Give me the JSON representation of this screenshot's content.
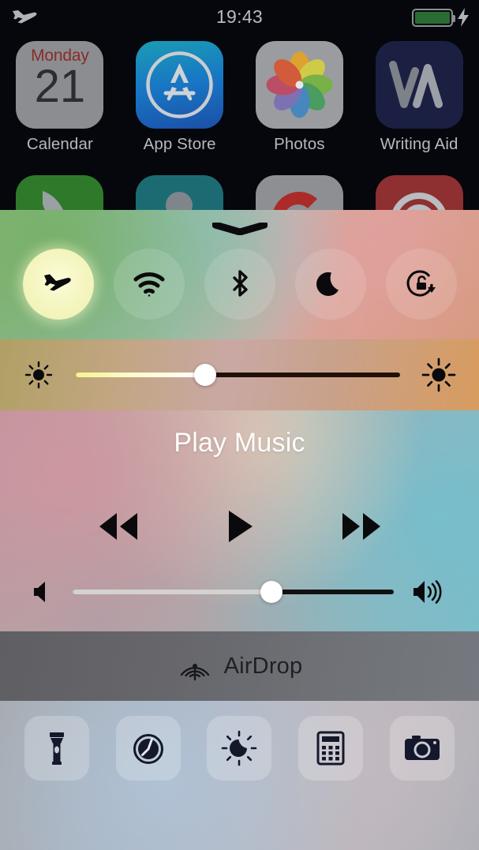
{
  "status_bar": {
    "airplane_icon": "airplane-icon",
    "time": "19:43",
    "battery_icon": "battery-full-icon",
    "battery_level_percent": 100,
    "battery_color": "#2a6b35",
    "charging_icon": "lightning-bolt-icon"
  },
  "home_screen": {
    "row1": [
      {
        "label": "Calendar",
        "icon": "calendar-icon",
        "day_of_week": "Monday",
        "day_number": "21",
        "bg": "#8b8d91"
      },
      {
        "label": "App Store",
        "icon": "app-store-icon",
        "bg": "#1876c4"
      },
      {
        "label": "Photos",
        "icon": "photos-icon",
        "bg": "#9a9ca0"
      },
      {
        "label": "Writing Aid",
        "icon": "writing-aid-icon",
        "bg": "#1b2043"
      }
    ],
    "row2_partial": [
      {
        "icon": "app-icon-green",
        "bg": "#2f7a2a"
      },
      {
        "icon": "app-icon-teal",
        "bg": "#1d6b72"
      },
      {
        "icon": "app-icon-gray",
        "bg": "#8d8f93"
      },
      {
        "icon": "app-icon-red",
        "bg": "#8e2f31"
      }
    ]
  },
  "control_center": {
    "grabber_icon": "chevron-grabber-handle",
    "toggles": [
      {
        "name": "airplane-mode",
        "icon": "airplane-icon",
        "active": true,
        "label": "Airplane Mode"
      },
      {
        "name": "wifi",
        "icon": "wifi-icon",
        "active": false,
        "label": "Wi-Fi"
      },
      {
        "name": "bluetooth",
        "icon": "bluetooth-icon",
        "active": false,
        "label": "Bluetooth"
      },
      {
        "name": "do-not-disturb",
        "icon": "moon-icon",
        "active": false,
        "label": "Do Not Disturb"
      },
      {
        "name": "rotation-lock",
        "icon": "rotation-lock-icon",
        "active": false,
        "label": "Rotation Lock"
      }
    ],
    "brightness": {
      "left_icon": "brightness-low-icon",
      "right_icon": "brightness-high-icon",
      "value_percent": 40
    },
    "media": {
      "title": "Play Music",
      "previous_icon": "rewind-icon",
      "play_icon": "play-icon",
      "next_icon": "fast-forward-icon",
      "volume": {
        "left_icon": "speaker-mute-icon",
        "right_icon": "speaker-loud-icon",
        "value_percent": 62
      }
    },
    "airdrop": {
      "label": "AirDrop",
      "icon": "airdrop-icon"
    },
    "shortcuts": [
      {
        "name": "flashlight",
        "icon": "flashlight-icon"
      },
      {
        "name": "timer",
        "icon": "timer-icon"
      },
      {
        "name": "night-shift",
        "icon": "night-shift-icon"
      },
      {
        "name": "calculator",
        "icon": "calculator-icon"
      },
      {
        "name": "camera",
        "icon": "camera-icon"
      }
    ]
  }
}
